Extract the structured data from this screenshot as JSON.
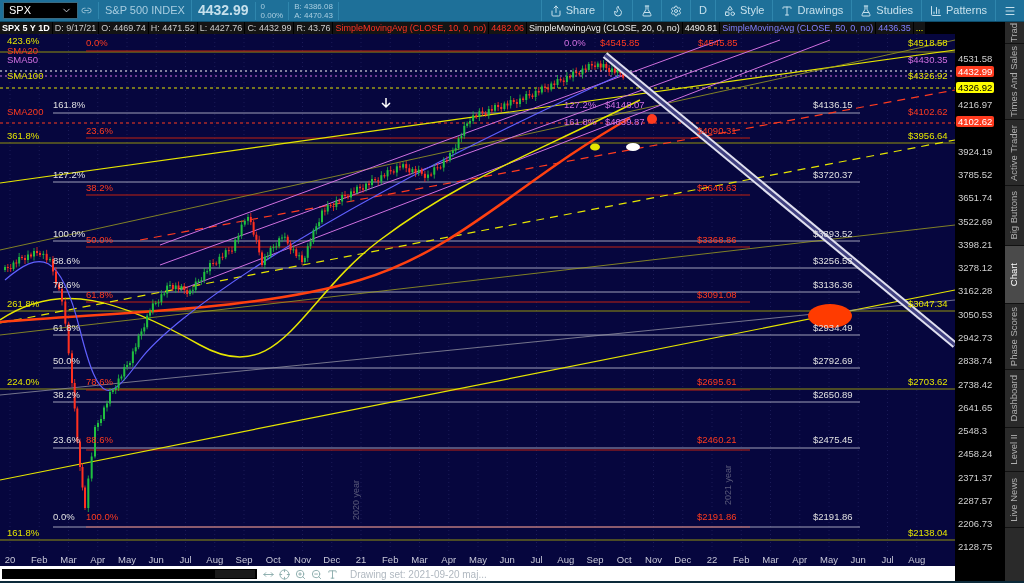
{
  "toolbar": {
    "symbol": "SPX",
    "description": "S&P 500 INDEX",
    "last": "4432.99",
    "change": "0",
    "change_pct": "0.00%",
    "bid": "B: 4386.08",
    "ask": "A: 4470.43",
    "buttons": [
      {
        "label": "Share"
      },
      {
        "label": "D"
      },
      {
        "label": "Style"
      },
      {
        "label": "Drawings"
      },
      {
        "label": "Studies"
      },
      {
        "label": "Patterns"
      }
    ]
  },
  "study_bar": [
    "SPX 5 Y 1D",
    "D: 9/17/21",
    "O: 4469.74",
    "H: 4471.52",
    "L: 4427.76",
    "C: 4432.99",
    "R: 43.76",
    "SimpleMovingAvg (CLOSE, 10, 0, no)",
    "4482.06",
    "SimpleMovingAvg (CLOSE, 20, 0, no)",
    "4490.81",
    "SimpleMovingAvg (CLOSE, 50, 0, no)",
    "4436.35",
    "..."
  ],
  "chart": {
    "annotations": [
      "423.6%",
      "0.0%",
      "0.0%",
      "$4545.85",
      "$4545.85",
      "$4518.58",
      "SMA20",
      "SMA50",
      "$4430.35",
      "SMA100",
      "$4326.92",
      "161.8%",
      "127.2%",
      "$4148.07",
      "$4136.15",
      "SMA200",
      "$4102.62",
      "161.8%",
      "$4039.87",
      "23.6%",
      "$4090.31",
      "361.8%",
      "$3956.64",
      "127.2%",
      "$3720.37",
      "38.2%",
      "$3646.63",
      "100.0%",
      "$3393.52",
      "50.0%",
      "$3368.86",
      "88.6%",
      "$3256.53",
      "78.6%",
      "$3136.36",
      "61.8%",
      "$3091.08",
      "261.8%",
      "$3047.34",
      "61.8%",
      "$2934.49",
      "50.0%",
      "$2792.69",
      "224.0%",
      "78.6%",
      "$2695.61",
      "$2703.62",
      "38.2%",
      "$2650.89",
      "23.6%",
      "88.6%",
      "$2460.21",
      "$2475.45",
      "0.0%",
      "100.0%",
      "$2191.86",
      "$2191.86",
      "161.8%",
      "$2138.04"
    ],
    "year_labels": [
      "2020 year",
      "2021 year"
    ]
  },
  "price_axis": [
    {
      "text": "4531.58",
      "kind": "tick"
    },
    {
      "text": "4432.99",
      "kind": "marker",
      "color": "#ff3b1f"
    },
    {
      "text": "4326.92",
      "kind": "marker",
      "color": "#ffff00"
    },
    {
      "text": "4216.97",
      "kind": "tick"
    },
    {
      "text": "4102.62",
      "kind": "marker",
      "color": "#ff3b1f"
    },
    {
      "text": "3924.19",
      "kind": "tick"
    },
    {
      "text": "3785.52",
      "kind": "tick"
    },
    {
      "text": "3651.74",
      "kind": "tick"
    },
    {
      "text": "3522.69",
      "kind": "tick"
    },
    {
      "text": "3398.21",
      "kind": "tick"
    },
    {
      "text": "3278.12",
      "kind": "tick"
    },
    {
      "text": "3162.28",
      "kind": "tick"
    },
    {
      "text": "3050.53",
      "kind": "tick"
    },
    {
      "text": "2942.73",
      "kind": "tick"
    },
    {
      "text": "2838.74",
      "kind": "tick"
    },
    {
      "text": "2738.42",
      "kind": "tick"
    },
    {
      "text": "2641.65",
      "kind": "tick"
    },
    {
      "text": "2548.3",
      "kind": "tick"
    },
    {
      "text": "2458.24",
      "kind": "tick"
    },
    {
      "text": "2371.37",
      "kind": "tick"
    },
    {
      "text": "2287.57",
      "kind": "tick"
    },
    {
      "text": "2206.73",
      "kind": "tick"
    },
    {
      "text": "2128.75",
      "kind": "tick"
    }
  ],
  "time_axis": [
    "20",
    "Feb",
    "Mar",
    "Apr",
    "May",
    "Jun",
    "Jul",
    "Aug",
    "Sep",
    "Oct",
    "Nov",
    "Dec",
    "21",
    "Feb",
    "Mar",
    "Apr",
    "May",
    "Jun",
    "Jul",
    "Aug",
    "Sep",
    "Oct",
    "Nov",
    "Dec",
    "22",
    "Feb",
    "Mar",
    "Apr",
    "May",
    "Jun",
    "Jul",
    "Aug"
  ],
  "side_tabs": [
    {
      "label": "Trad",
      "selected": false
    },
    {
      "label": "Times And Sales",
      "selected": false
    },
    {
      "label": "Active Trader",
      "selected": false
    },
    {
      "label": "Big Buttons",
      "selected": false
    },
    {
      "label": "Chart",
      "selected": true
    },
    {
      "label": "Phase Scores",
      "selected": false
    },
    {
      "label": "Dashboard",
      "selected": false
    },
    {
      "label": "Level II",
      "selected": false
    },
    {
      "label": "Live News",
      "selected": false
    }
  ],
  "bottom_bar": {
    "drawing_set": "Drawing set: 2021-09-20 maj..."
  }
}
